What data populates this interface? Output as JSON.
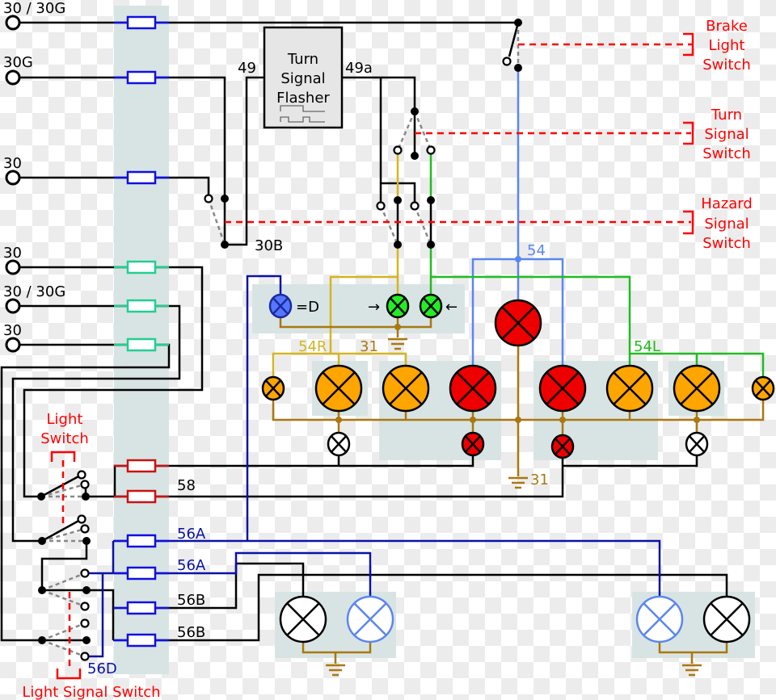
{
  "terminals": [
    {
      "label": "30 / 30G"
    },
    {
      "label": "30G"
    },
    {
      "label": "30"
    },
    {
      "label": "30"
    },
    {
      "label": "30 / 30G"
    },
    {
      "label": "30"
    }
  ],
  "flasher": {
    "lines": [
      "Turn",
      "Signal",
      "Flasher"
    ],
    "input_label": "49",
    "output_label": "49a"
  },
  "terminal_30b": "30B",
  "switches": {
    "brake": [
      "Brake",
      "Light",
      "Switch"
    ],
    "turn": [
      "Turn",
      "Signal",
      "Switch"
    ],
    "hazard": [
      "Hazard",
      "Signal",
      "Switch"
    ],
    "light": [
      "Light",
      "Switch"
    ],
    "light_signal": "Light Signal Switch"
  },
  "circuit_labels": {
    "c58": "58",
    "c56a_1": "56A",
    "c56a_2": "56A",
    "c56b_1": "56B",
    "c56b_2": "56B",
    "c56d": "56D",
    "c54": "54",
    "c54l": "54L",
    "c54r": "54R",
    "ground_31_dash": "31",
    "ground_31_main": "31"
  },
  "indicators": {
    "dynamo": "=D",
    "right_arrow": "→",
    "left_arrow": "←"
  },
  "colors": {
    "fuse_30": "#1010e0",
    "fuse_green": "#20d090",
    "fuse_58": "#cc1111",
    "wire_54": "#5b86f0",
    "wire_54r": "#d4b520",
    "wire_54l": "#22bb22",
    "wire_56": "#0a12a8",
    "ground_31": "#aa7711",
    "mechanical_link": "#ff0000",
    "lamp_turn": "#ffa500",
    "lamp_brake": "#ee0000",
    "lamp_indicator_green": "#22ee22",
    "lamp_indicator_blue": "#5577ff"
  }
}
